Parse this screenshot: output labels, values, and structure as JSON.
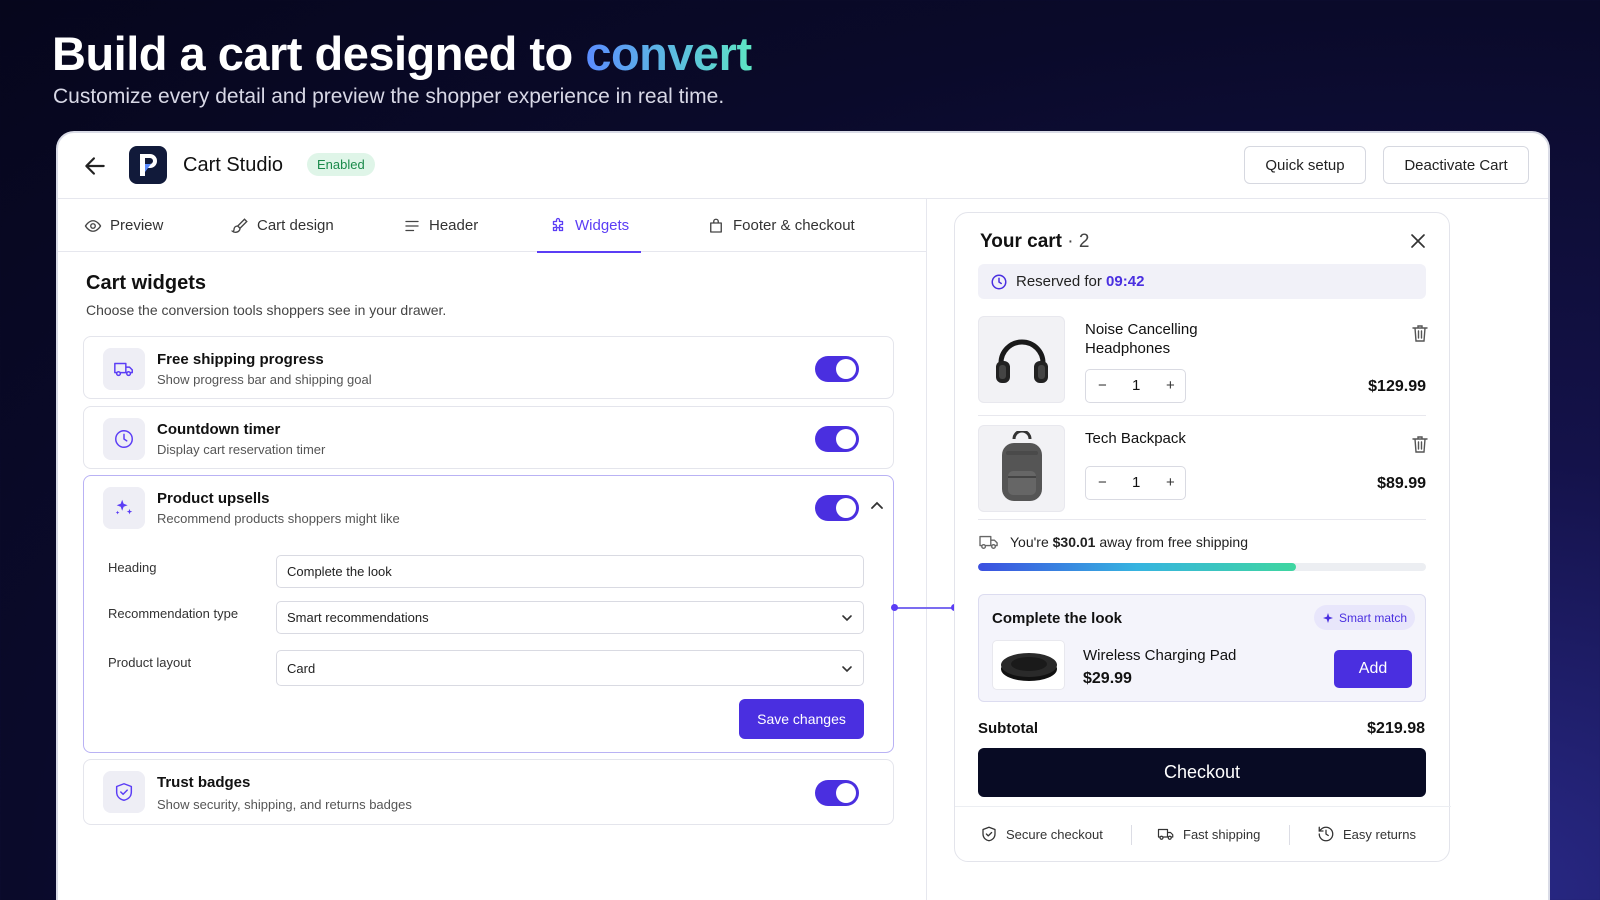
{
  "hero": {
    "title_main": "Build a cart designed to ",
    "title_accent": "convert",
    "subtitle": "Customize every detail and preview the shopper experience in real time."
  },
  "app": {
    "title": "Cart Studio",
    "status_badge": "Enabled",
    "quick_setup_label": "Quick setup",
    "deactivate_label": "Deactivate Cart"
  },
  "tabs": [
    {
      "label": "Preview",
      "icon": "eye-icon"
    },
    {
      "label": "Cart design",
      "icon": "brush-icon"
    },
    {
      "label": "Header",
      "icon": "menu-lines-icon"
    },
    {
      "label": "Widgets",
      "icon": "puzzle-icon",
      "active": true
    },
    {
      "label": "Footer & checkout",
      "icon": "bag-icon"
    }
  ],
  "widgets_section": {
    "title": "Cart widgets",
    "description": "Choose the conversion tools shoppers see in your drawer."
  },
  "widgets": [
    {
      "title": "Free shipping progress",
      "subtitle": "Show progress bar and shipping goal",
      "enabled": true,
      "icon": "truck-icon"
    },
    {
      "title": "Countdown timer",
      "subtitle": "Display cart reservation timer",
      "enabled": true,
      "icon": "clock-icon"
    },
    {
      "title": "Product upsells",
      "subtitle": "Recommend products shoppers might like",
      "enabled": true,
      "icon": "sparkles-icon",
      "expanded": true
    },
    {
      "title": "Trust badges",
      "subtitle": "Show security, shipping, and returns badges",
      "enabled": true,
      "icon": "shield-check-icon"
    }
  ],
  "upsell_form": {
    "heading_label": "Heading",
    "heading_value": "Complete the look",
    "rec_type_label": "Recommendation type",
    "rec_type_value": "Smart recommendations",
    "layout_label": "Product layout",
    "layout_value": "Card",
    "save_label": "Save changes"
  },
  "cart": {
    "title": "Your cart",
    "count_text": " · 2",
    "reserved_text": "Reserved for ",
    "reserved_time": "09:42",
    "items": [
      {
        "name": "Noise Cancelling Headphones",
        "qty": "1",
        "price": "$129.99"
      },
      {
        "name": "Tech Backpack",
        "qty": "1",
        "price": "$89.99"
      }
    ],
    "shipping_prefix": "You're ",
    "shipping_amount": "$30.01",
    "shipping_suffix": " away from free shipping",
    "shipping_progress": 0.71,
    "upsell": {
      "title": "Complete the look",
      "badge": "Smart match",
      "product_name": "Wireless Charging Pad",
      "product_price": "$29.99",
      "add_label": "Add"
    },
    "subtotal_label": "Subtotal",
    "subtotal_value": "$219.98",
    "checkout_label": "Checkout",
    "trust_badges": [
      "Secure checkout",
      "Fast shipping",
      "Easy returns"
    ]
  },
  "colors": {
    "accent": "#4a2fe0",
    "checkout_bg": "#080b24",
    "badge_green_bg": "#dff5e8",
    "badge_green_text": "#1a8a4a"
  }
}
